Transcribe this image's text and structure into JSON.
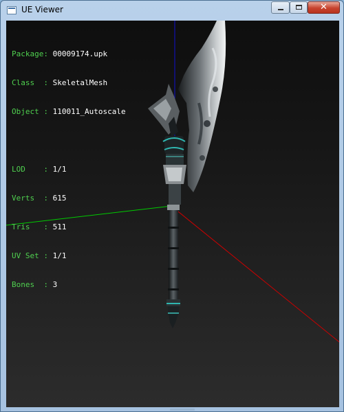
{
  "window": {
    "title": "UE Viewer",
    "close_symbol": "✕"
  },
  "icons": {
    "app": "app-window-icon",
    "minimize": "minimize-icon",
    "maximize": "maximize-icon",
    "close": "close-icon"
  },
  "info": {
    "package": {
      "label": "Package: ",
      "value": "00009174.upk"
    },
    "class": {
      "label": "Class  : ",
      "value": "SkeletalMesh"
    },
    "object": {
      "label": "Object : ",
      "value": "110011_Autoscale"
    },
    "lod": {
      "label": "LOD    : ",
      "value": "1/1"
    },
    "verts": {
      "label": "Verts  : ",
      "value": "615"
    },
    "tris": {
      "label": "Tris   : ",
      "value": "511"
    },
    "uvset": {
      "label": "UV Set : ",
      "value": "1/1"
    },
    "bones": {
      "label": "Bones  : ",
      "value": "3"
    }
  },
  "colors": {
    "info_label": "#4fd04f",
    "info_value": "#ffffff",
    "axis_x": "#cc0000",
    "axis_y": "#00cc00",
    "axis_z": "#1010d0",
    "viewport_top": "#0e0e0e",
    "viewport_bottom": "#2c2c2c"
  }
}
